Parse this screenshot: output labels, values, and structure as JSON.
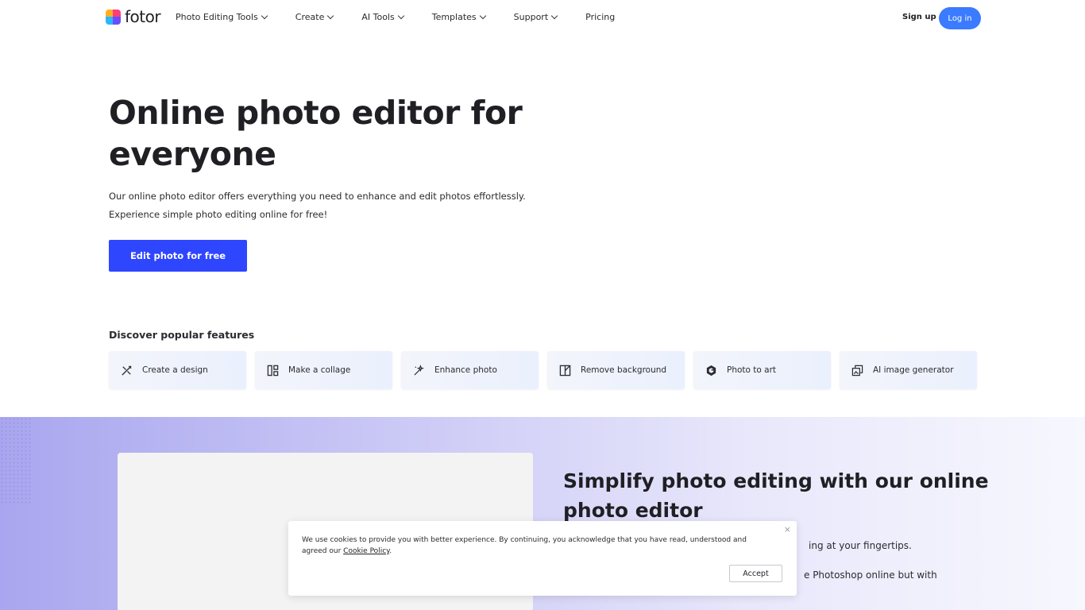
{
  "brand": {
    "name": "fotor"
  },
  "nav": {
    "menu": [
      {
        "label": "Photo Editing Tools",
        "has_dropdown": true
      },
      {
        "label": "Create",
        "has_dropdown": true
      },
      {
        "label": "AI Tools",
        "has_dropdown": true
      },
      {
        "label": "Templates",
        "has_dropdown": true
      },
      {
        "label": "Support",
        "has_dropdown": true
      },
      {
        "label": "Pricing",
        "has_dropdown": false
      }
    ],
    "signup_label": "Sign up",
    "login_label": "Log in"
  },
  "hero": {
    "title": "Online photo editor for everyone",
    "desc_line1": "Our online photo editor offers everything you need to enhance and edit photos effortlessly.",
    "desc_line2": "Experience simple photo editing online for free!",
    "cta_label": "Edit photo for free"
  },
  "features": {
    "title": "Discover popular features",
    "items": [
      {
        "label": "Create a design",
        "icon": "design-icon"
      },
      {
        "label": "Make a collage",
        "icon": "collage-icon"
      },
      {
        "label": "Enhance photo",
        "icon": "enhance-icon"
      },
      {
        "label": "Remove background",
        "icon": "remove-background-icon"
      },
      {
        "label": "Photo to art",
        "icon": "photo-to-art-icon"
      },
      {
        "label": "AI image generator",
        "icon": "ai-image-generator-icon"
      }
    ]
  },
  "section": {
    "title": "Simplify photo editing with our online photo editor",
    "text1": "ing at your fingertips.",
    "text2": "e Photoshop online but with"
  },
  "cookie": {
    "text": "We use cookies to provide you with better experience. By continuing, you acknowledge that you have read, understood and agreed our",
    "link_label": "Cookie Policy",
    "after_link": ".",
    "accept_label": "Accept",
    "close_label": "×"
  },
  "colors": {
    "primary": "#2f46ff",
    "login": "#3a7bff",
    "text": "#1f1f24"
  }
}
